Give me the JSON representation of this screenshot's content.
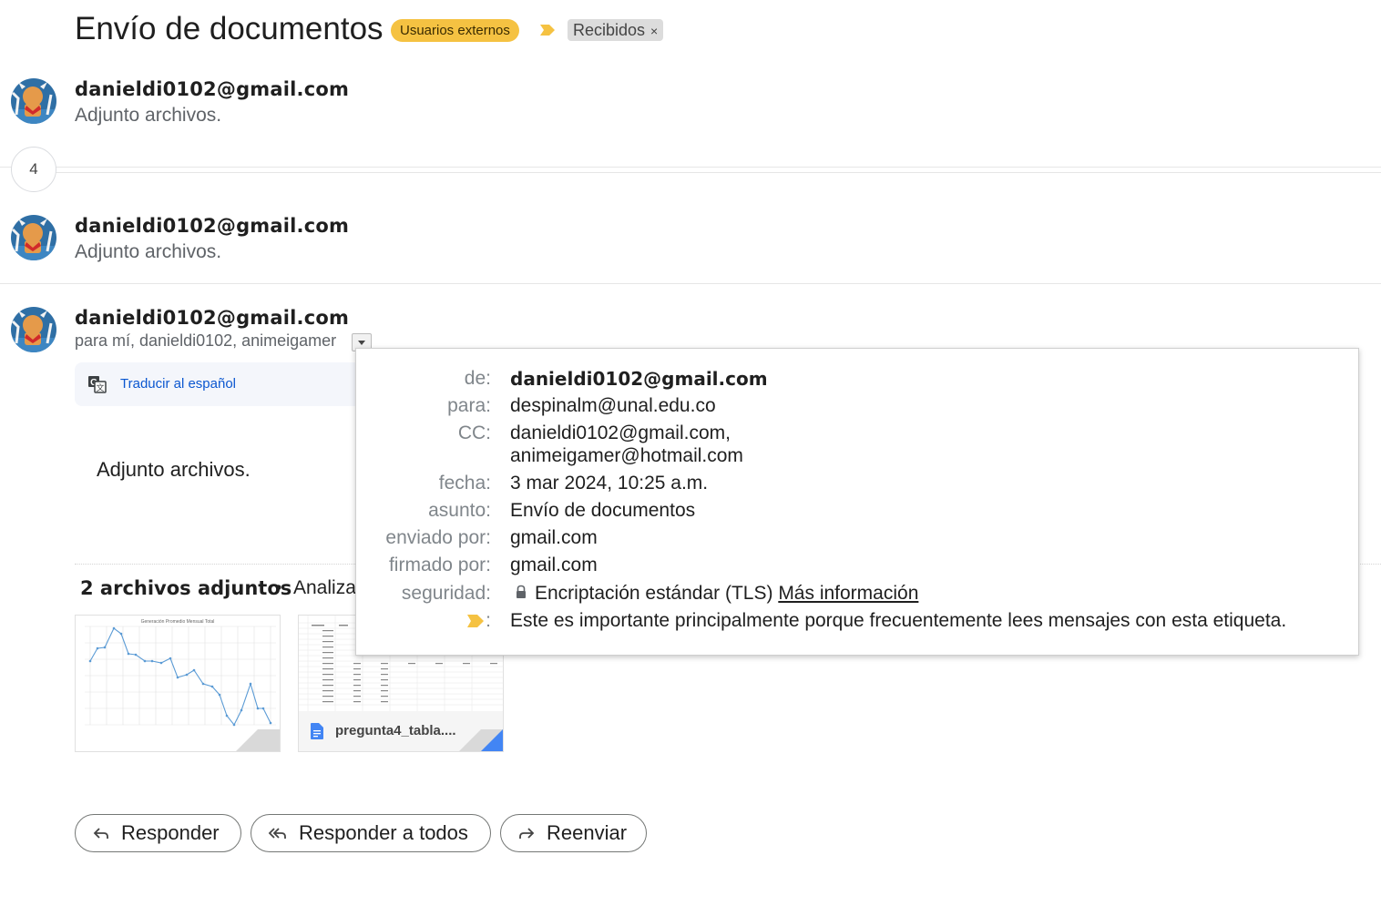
{
  "thread": {
    "subject": "Envío de documentos",
    "labels": {
      "category": "Usuarios externos",
      "inbox": "Recibidos",
      "remove_glyph": "×"
    },
    "label_arrow_color": "#f5c242"
  },
  "messages": [
    {
      "sender": "danieldi0102@gmail.com",
      "snippet": "Adjunto archivos."
    },
    {
      "sender": "danieldi0102@gmail.com",
      "snippet": "Adjunto archivos."
    },
    {
      "sender": "danieldi0102@gmail.com",
      "recipients": "para mí, danieldi0102, animeigamer"
    }
  ],
  "collapsed_count": "4",
  "translate": {
    "label": "Traducir al español",
    "icon": "translate-icon"
  },
  "body": "Adjunto archivos.",
  "attachments": {
    "count_label": "2 archivos adjuntos",
    "separator": "•",
    "scan_label": "Analiza",
    "files": [
      {
        "type": "image",
        "caption": "Generación Promedio Mensual Total"
      },
      {
        "type": "document",
        "name": "pregunta4_tabla...."
      }
    ]
  },
  "details": {
    "from_key": "de:",
    "from": "danieldi0102@gmail.com",
    "to_key": "para:",
    "to": "despinalm@unal.edu.co",
    "cc_key": "CC:",
    "cc_line1": "danieldi0102@gmail.com,",
    "cc_line2": "animeigamer@hotmail.com",
    "date_key": "fecha:",
    "date": "3 mar 2024, 10:25 a.m.",
    "subject_key": "asunto:",
    "subject": "Envío de documentos",
    "mailedby_key": "enviado por:",
    "mailedby": "gmail.com",
    "signedby_key": "firmado por:",
    "signedby": "gmail.com",
    "security_key": "seguridad:",
    "security": "Encriptación estándar (TLS)",
    "security_link": "Más información",
    "importance_key": ":",
    "importance": "Este es importante principalmente porque frecuentemente lees mensajes con esta etiqueta."
  },
  "actions": {
    "reply": "Responder",
    "reply_all": "Responder a todos",
    "forward": "Reenviar"
  }
}
